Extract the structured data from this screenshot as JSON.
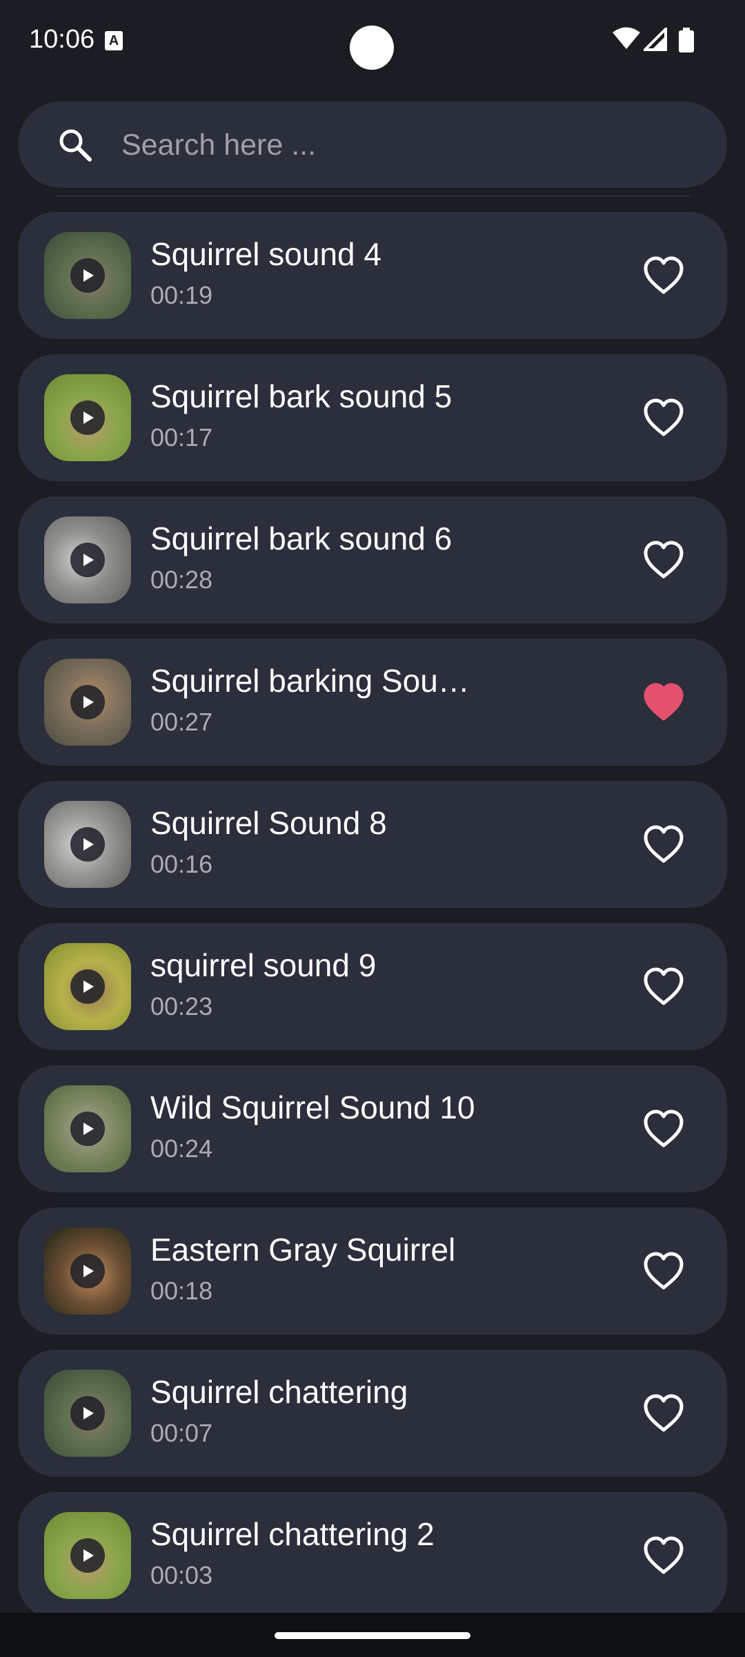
{
  "status_bar": {
    "time": "10:06",
    "a_badge": "A",
    "icons": [
      "wifi-icon",
      "signal-icon",
      "battery-icon"
    ]
  },
  "search": {
    "placeholder": "Search here ...",
    "value": ""
  },
  "colors": {
    "background": "#1b1d23",
    "card": "#2b2e3b",
    "favorite_active": "#e5506f",
    "text_secondary": "#a9acb6"
  },
  "sounds": [
    {
      "title": "Squirrel sound 4",
      "duration": "00:19",
      "favorite": false
    },
    {
      "title": "Squirrel bark sound 5",
      "duration": "00:17",
      "favorite": false
    },
    {
      "title": "Squirrel bark sound 6",
      "duration": "00:28",
      "favorite": false
    },
    {
      "title": "Squirrel barking Sou…",
      "duration": "00:27",
      "favorite": true
    },
    {
      "title": "Squirrel Sound 8",
      "duration": "00:16",
      "favorite": false
    },
    {
      "title": "squirrel sound 9",
      "duration": "00:23",
      "favorite": false
    },
    {
      "title": "Wild Squirrel Sound 10",
      "duration": "00:24",
      "favorite": false
    },
    {
      "title": "Eastern Gray Squirrel",
      "duration": "00:18",
      "favorite": false
    },
    {
      "title": "Squirrel chattering",
      "duration": "00:07",
      "favorite": false
    },
    {
      "title": "Squirrel chattering 2",
      "duration": "00:03",
      "favorite": false
    }
  ]
}
